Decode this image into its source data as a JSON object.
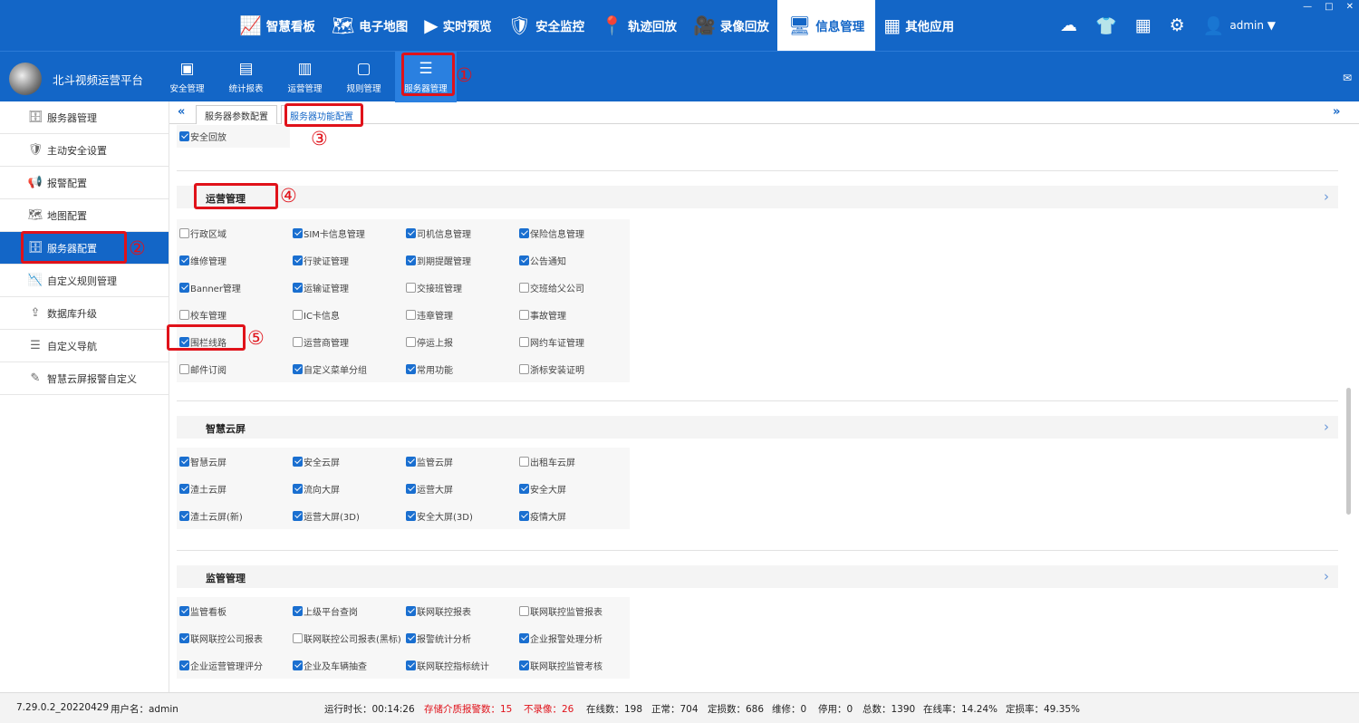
{
  "topnav": [
    {
      "icon": "📈",
      "label": "智慧看板"
    },
    {
      "icon": "🗺",
      "label": "电子地图"
    },
    {
      "icon": "▶",
      "label": "实时预览"
    },
    {
      "icon": "🛡",
      "label": "安全监控"
    },
    {
      "icon": "📍",
      "label": "轨迹回放"
    },
    {
      "icon": "🎥",
      "label": "录像回放"
    },
    {
      "icon": "🖥",
      "label": "信息管理"
    },
    {
      "icon": "▦",
      "label": "其他应用"
    }
  ],
  "topright": {
    "user": "admin ▼"
  },
  "brand": {
    "name": "北斗视频运营平台"
  },
  "subnav": [
    {
      "icon": "▣",
      "label": "安全管理"
    },
    {
      "icon": "▤",
      "label": "统计报表"
    },
    {
      "icon": "▥",
      "label": "运营管理"
    },
    {
      "icon": "▢",
      "label": "规则管理"
    },
    {
      "icon": "☰",
      "label": "服务器管理"
    }
  ],
  "sidebar": [
    {
      "icon": "🗄",
      "label": "服务器管理"
    },
    {
      "icon": "🛡",
      "label": "主动安全设置"
    },
    {
      "icon": "📢",
      "label": "报警配置"
    },
    {
      "icon": "🗺",
      "label": "地图配置"
    },
    {
      "icon": "🗄",
      "label": "服务器配置"
    },
    {
      "icon": "📉",
      "label": "自定义规则管理"
    },
    {
      "icon": "⇪",
      "label": "数据库升级"
    },
    {
      "icon": "☰",
      "label": "自定义导航"
    },
    {
      "icon": "✎",
      "label": "智慧云屏报警自定义"
    }
  ],
  "tabs": {
    "left_chev": "«",
    "right_chev": "»",
    "tab1": "服务器参数配置",
    "tab2": "服务器功能配置"
  },
  "annotations": [
    "①",
    "②",
    "③",
    "④",
    "⑤"
  ],
  "top_item": {
    "label": "安全回放",
    "checked": true
  },
  "sections": [
    {
      "title": "运营管理",
      "arrow": "›",
      "rows": [
        [
          {
            "l": "行政区域",
            "c": false
          },
          {
            "l": "SIM卡信息管理",
            "c": true
          },
          {
            "l": "司机信息管理",
            "c": true
          },
          {
            "l": "保险信息管理",
            "c": true
          }
        ],
        [
          {
            "l": "维修管理",
            "c": true
          },
          {
            "l": "行驶证管理",
            "c": true
          },
          {
            "l": "到期提醒管理",
            "c": true
          },
          {
            "l": "公告通知",
            "c": true
          }
        ],
        [
          {
            "l": "Banner管理",
            "c": true
          },
          {
            "l": "运输证管理",
            "c": true
          },
          {
            "l": "交接班管理",
            "c": false
          },
          {
            "l": "交班给父公司",
            "c": false
          }
        ],
        [
          {
            "l": "校车管理",
            "c": false
          },
          {
            "l": "IC卡信息",
            "c": false
          },
          {
            "l": "违章管理",
            "c": false
          },
          {
            "l": "事故管理",
            "c": false
          }
        ],
        [
          {
            "l": "围栏线路",
            "c": true
          },
          {
            "l": "运营商管理",
            "c": false
          },
          {
            "l": "停运上报",
            "c": false
          },
          {
            "l": "网约车证管理",
            "c": false
          }
        ],
        [
          {
            "l": "邮件订阅",
            "c": false
          },
          {
            "l": "自定义菜单分组",
            "c": true
          },
          {
            "l": "常用功能",
            "c": true
          },
          {
            "l": "浙标安装证明",
            "c": false
          }
        ]
      ]
    },
    {
      "title": "智慧云屏",
      "arrow": "›",
      "rows": [
        [
          {
            "l": "智慧云屏",
            "c": true
          },
          {
            "l": "安全云屏",
            "c": true
          },
          {
            "l": "监管云屏",
            "c": true
          },
          {
            "l": "出租车云屏",
            "c": false
          }
        ],
        [
          {
            "l": "渣土云屏",
            "c": true
          },
          {
            "l": "流向大屏",
            "c": true
          },
          {
            "l": "运营大屏",
            "c": true
          },
          {
            "l": "安全大屏",
            "c": true
          }
        ],
        [
          {
            "l": "渣土云屏(新)",
            "c": true
          },
          {
            "l": "运营大屏(3D)",
            "c": true
          },
          {
            "l": "安全大屏(3D)",
            "c": true
          },
          {
            "l": "疫情大屏",
            "c": true
          }
        ]
      ]
    },
    {
      "title": "监管管理",
      "arrow": "›",
      "rows": [
        [
          {
            "l": "监管看板",
            "c": true
          },
          {
            "l": "上级平台查岗",
            "c": true
          },
          {
            "l": "联网联控报表",
            "c": true
          },
          {
            "l": "联网联控监管报表",
            "c": false
          }
        ],
        [
          {
            "l": "联网联控公司报表",
            "c": true
          },
          {
            "l": "联网联控公司报表(黑标)",
            "c": false
          },
          {
            "l": "报警统计分析",
            "c": true
          },
          {
            "l": "企业报警处理分析",
            "c": true
          }
        ],
        [
          {
            "l": "企业运营管理评分",
            "c": true
          },
          {
            "l": "企业及车辆抽查",
            "c": true
          },
          {
            "l": "联网联控指标统计",
            "c": true
          },
          {
            "l": "联网联控监管考核",
            "c": true
          }
        ]
      ]
    }
  ],
  "status": {
    "version": "7.29.0.2_20220429",
    "user": "用户名：admin",
    "runtime": "运行时长：00:14:26",
    "storage_alarm": "存储介质报警数：15",
    "no_record": "不录像：26",
    "online": "在线数：198",
    "normal": "正常：704",
    "loss": "定损数：686",
    "repair": "维修：0",
    "stopped": "停用：0",
    "total": "总数：1390",
    "online_rate": "在线率：14.24%",
    "loss_rate": "定损率：49.35%"
  }
}
